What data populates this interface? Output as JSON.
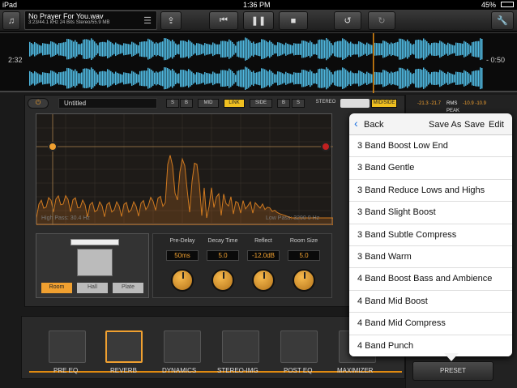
{
  "status": {
    "carrier": "iPad",
    "time": "1:36 PM",
    "battery": "45%"
  },
  "file": {
    "name": "No Prayer For You.wav",
    "meta": "3:23/44.1 kHz 24 Bits Stereo/55.9 MB"
  },
  "wave": {
    "elapsed": "2:32",
    "remaining": "- 0:50"
  },
  "preset_name": "Untitled",
  "mode_buttons": [
    "S",
    "B",
    "MID",
    "LINK",
    "SIDE",
    "B",
    "S"
  ],
  "stereo": {
    "left": "STEREO",
    "right": "MID/SIDE"
  },
  "meter": {
    "l": "-21.3 -21.7",
    "rms": "RMS",
    "r": "-10.9 -10.9",
    "peak": "PEAK"
  },
  "eq": {
    "highpass": "High Pass: 30.4 Hz",
    "lowpass": "Low Pass: 3290 0 Hz"
  },
  "room_buttons": [
    "Room",
    "Hall",
    "Plate"
  ],
  "params": [
    {
      "label": "Pre-Delay",
      "value": "50ms"
    },
    {
      "label": "Decay Time",
      "value": "5.0"
    },
    {
      "label": "Reflect",
      "value": "-12.0dB"
    },
    {
      "label": "Room Size",
      "value": "5.0"
    }
  ],
  "chain": [
    "PRE EQ",
    "REVERB",
    "DYNAMICS",
    "STEREO-IMG",
    "POST EQ",
    "MAXIMIZER"
  ],
  "popup": {
    "back": "Back",
    "save_as": "Save As",
    "save": "Save",
    "edit": "Edit",
    "items": [
      "3 Band Boost Low End",
      "3 Band Gentle",
      "3 Band Reduce Lows and Highs",
      "3 Band Slight Boost",
      "3 Band Subtle Compress",
      "3 Band Warm",
      "4 Band Boost Bass and Ambience",
      "4 Band Mid Boost",
      "4 Band Mid Compress",
      "4 Band Punch"
    ]
  },
  "preset_button": "PRESET",
  "colors": {
    "accent": "#f0a030",
    "wave": "#4fb8e0",
    "link": "#f0c020"
  }
}
